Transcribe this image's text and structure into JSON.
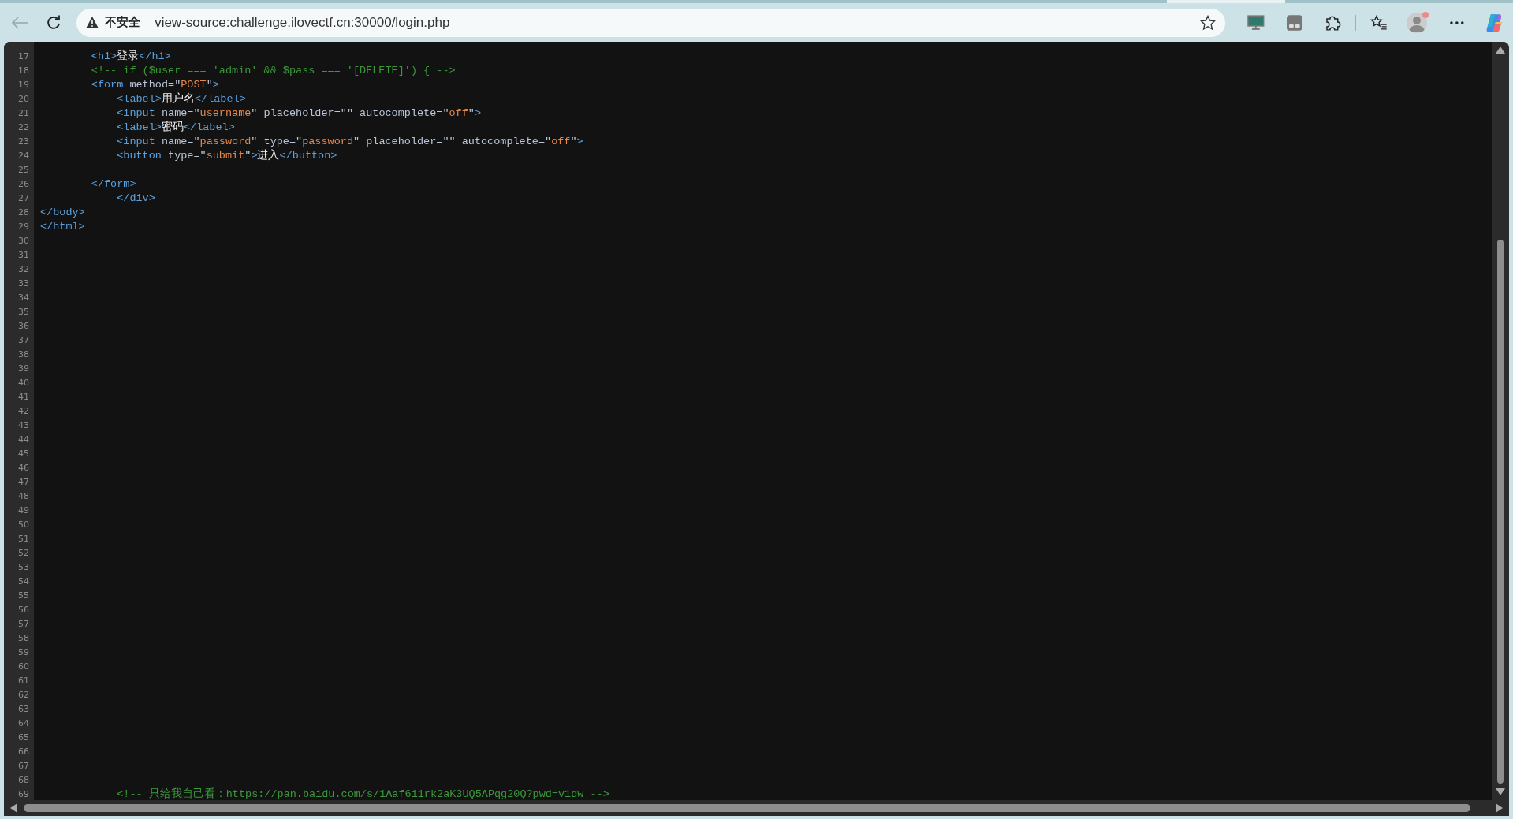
{
  "browser": {
    "back_disabled": true,
    "security_label": "不安全",
    "url": "view-source:challenge.ilovectf.cn:30000/login.php"
  },
  "source": {
    "lines": [
      {
        "number": "17",
        "tokens": [
          {
            "kind": "tag",
            "text": "        <h1>"
          },
          {
            "kind": "text",
            "text": "登录"
          },
          {
            "kind": "tag",
            "text": "</h1>"
          }
        ]
      },
      {
        "number": "18",
        "tokens": [
          {
            "kind": "comment",
            "text": "        <!-- if ($user === 'admin' && $pass === '[DELETE]') { -->"
          }
        ]
      },
      {
        "number": "19",
        "tokens": [
          {
            "kind": "tag",
            "text": "        <form"
          },
          {
            "kind": "attr",
            "text": " method=\""
          },
          {
            "kind": "value",
            "text": "POST"
          },
          {
            "kind": "attr",
            "text": "\""
          },
          {
            "kind": "tag",
            "text": ">"
          }
        ]
      },
      {
        "number": "20",
        "tokens": [
          {
            "kind": "tag",
            "text": "            <label>"
          },
          {
            "kind": "text",
            "text": "用户名"
          },
          {
            "kind": "tag",
            "text": "</label>"
          }
        ]
      },
      {
        "number": "21",
        "tokens": [
          {
            "kind": "tag",
            "text": "            <input"
          },
          {
            "kind": "attr",
            "text": " name=\""
          },
          {
            "kind": "value",
            "text": "username"
          },
          {
            "kind": "attr",
            "text": "\" placeholder=\"\" autocomplete=\""
          },
          {
            "kind": "value",
            "text": "off"
          },
          {
            "kind": "attr",
            "text": "\""
          },
          {
            "kind": "tag",
            "text": ">"
          }
        ]
      },
      {
        "number": "22",
        "tokens": [
          {
            "kind": "tag",
            "text": "            <label>"
          },
          {
            "kind": "text",
            "text": "密码"
          },
          {
            "kind": "tag",
            "text": "</label>"
          }
        ]
      },
      {
        "number": "23",
        "tokens": [
          {
            "kind": "tag",
            "text": "            <input"
          },
          {
            "kind": "attr",
            "text": " name=\""
          },
          {
            "kind": "value",
            "text": "password"
          },
          {
            "kind": "attr",
            "text": "\" type=\""
          },
          {
            "kind": "value",
            "text": "password"
          },
          {
            "kind": "attr",
            "text": "\" placeholder=\"\" autocomplete=\""
          },
          {
            "kind": "value",
            "text": "off"
          },
          {
            "kind": "attr",
            "text": "\""
          },
          {
            "kind": "tag",
            "text": ">"
          }
        ]
      },
      {
        "number": "24",
        "tokens": [
          {
            "kind": "tag",
            "text": "            <button"
          },
          {
            "kind": "attr",
            "text": " type=\""
          },
          {
            "kind": "value",
            "text": "submit"
          },
          {
            "kind": "attr",
            "text": "\""
          },
          {
            "kind": "tag",
            "text": ">"
          },
          {
            "kind": "text",
            "text": "进入"
          },
          {
            "kind": "tag",
            "text": "</button>"
          }
        ]
      },
      {
        "number": "25"
      },
      {
        "number": "26",
        "tokens": [
          {
            "kind": "tag",
            "text": "        </form>"
          }
        ]
      },
      {
        "number": "27",
        "tokens": [
          {
            "kind": "tag",
            "text": "            </div>"
          }
        ]
      },
      {
        "number": "28",
        "tokens": [
          {
            "kind": "tag",
            "text": "</body>"
          }
        ]
      },
      {
        "number": "29",
        "tokens": [
          {
            "kind": "tag",
            "text": "</html>"
          }
        ]
      },
      {
        "number": "30"
      },
      {
        "number": "31"
      },
      {
        "number": "32"
      },
      {
        "number": "33"
      },
      {
        "number": "34"
      },
      {
        "number": "35"
      },
      {
        "number": "36"
      },
      {
        "number": "37"
      },
      {
        "number": "38"
      },
      {
        "number": "39"
      },
      {
        "number": "40"
      },
      {
        "number": "41"
      },
      {
        "number": "42"
      },
      {
        "number": "43"
      },
      {
        "number": "44"
      },
      {
        "number": "45"
      },
      {
        "number": "46"
      },
      {
        "number": "47"
      },
      {
        "number": "48"
      },
      {
        "number": "49"
      },
      {
        "number": "50"
      },
      {
        "number": "51"
      },
      {
        "number": "52"
      },
      {
        "number": "53"
      },
      {
        "number": "54"
      },
      {
        "number": "55"
      },
      {
        "number": "56"
      },
      {
        "number": "57"
      },
      {
        "number": "58"
      },
      {
        "number": "59"
      },
      {
        "number": "60"
      },
      {
        "number": "61"
      },
      {
        "number": "62"
      },
      {
        "number": "63"
      },
      {
        "number": "64"
      },
      {
        "number": "65"
      },
      {
        "number": "66"
      },
      {
        "number": "67"
      },
      {
        "number": "68"
      },
      {
        "number": "69",
        "tokens": [
          {
            "kind": "comment",
            "text": "            <!-- 只给我自己看：https://pan.baidu.com/s/1Aaf6i1rk2aK3UQ5APqg20Q?pwd=v1dw -->"
          }
        ]
      }
    ]
  }
}
